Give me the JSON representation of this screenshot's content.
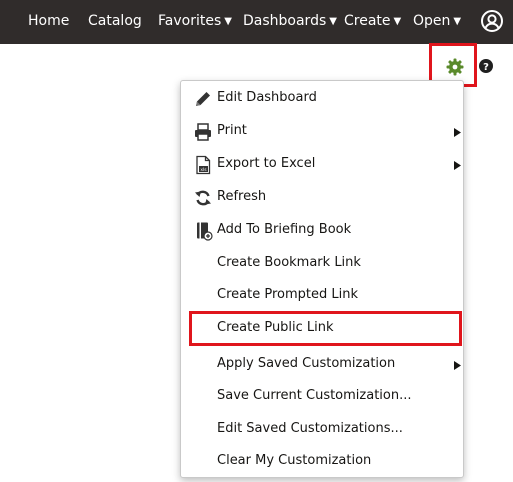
{
  "nav": {
    "home": "Home",
    "catalog": "Catalog",
    "favorites": "Favorites",
    "dashboards": "Dashboards",
    "create": "Create",
    "open": "Open",
    "caret": "▼"
  },
  "icons": {
    "gear": "gear-icon",
    "help": "help-icon",
    "user": "user-icon"
  },
  "colors": {
    "topbar": "#302c2b",
    "gear": "#5a8a2b",
    "highlight": "#e0151c"
  },
  "menu": {
    "items": [
      {
        "label": "Edit Dashboard"
      },
      {
        "label": "Print"
      },
      {
        "label": "Export to Excel"
      },
      {
        "label": "Refresh"
      },
      {
        "label": "Add To Briefing Book"
      },
      {
        "label": "Create Bookmark Link"
      },
      {
        "label": "Create Prompted Link"
      },
      {
        "label": "Create Public Link"
      },
      {
        "label": "Apply Saved Customization"
      },
      {
        "label": "Save Current Customization..."
      },
      {
        "label": "Edit Saved Customizations..."
      },
      {
        "label": "Clear My Customization"
      }
    ]
  }
}
